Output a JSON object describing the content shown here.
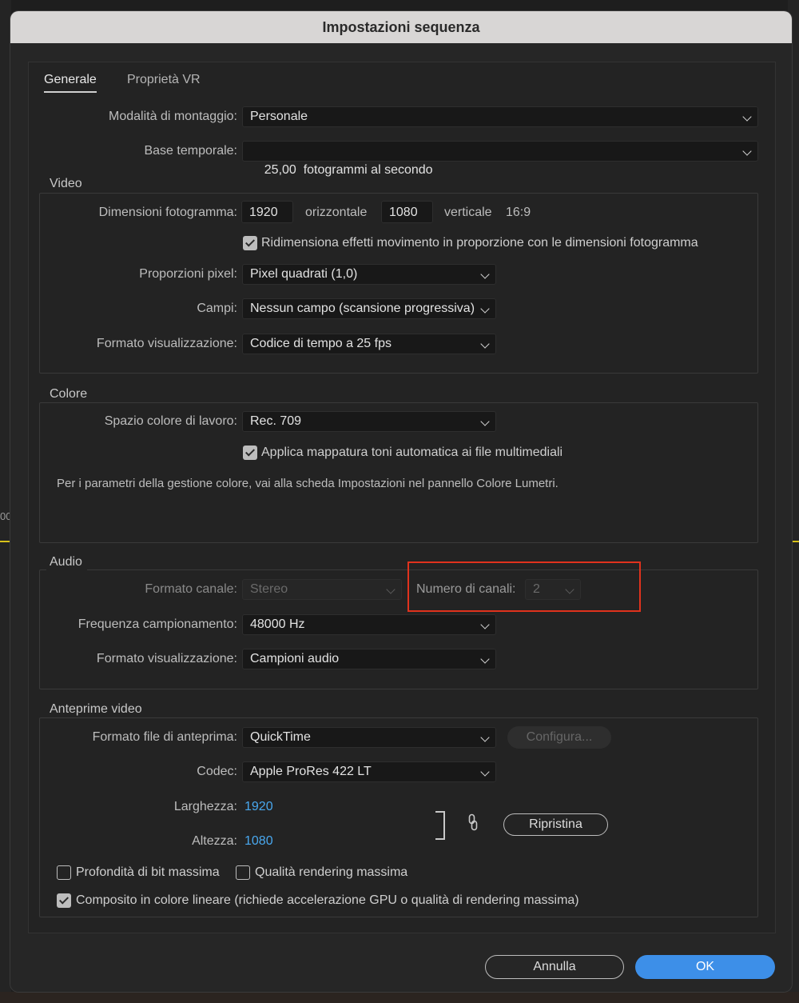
{
  "window": {
    "title": "Impostazioni sequenza"
  },
  "background": {
    "ruler_fragment": "00"
  },
  "tabs": [
    {
      "label": "Generale",
      "active": true
    },
    {
      "label": "Proprietà VR",
      "active": false
    }
  ],
  "general": {
    "editing_mode_label": "Modalità di montaggio:",
    "editing_mode_value": "Personale",
    "timebase_label": "Base temporale:",
    "timebase_value": "25,00  fotogrammi al secondo"
  },
  "video": {
    "title": "Video",
    "frame_size_label": "Dimensioni fotogramma:",
    "width": "1920",
    "horizontal_label": "orizzontale",
    "height": "1080",
    "vertical_label": "verticale",
    "aspect": "16:9",
    "scale_effects_checked": true,
    "scale_effects_label": "Ridimensiona effetti movimento in proporzione con le dimensioni fotogramma",
    "pixel_aspect_label": "Proporzioni pixel:",
    "pixel_aspect_value": "Pixel quadrati (1,0)",
    "fields_label": "Campi:",
    "fields_value": "Nessun campo (scansione progressiva)",
    "display_format_label": "Formato visualizzazione:",
    "display_format_value": "Codice di tempo a 25 fps"
  },
  "color": {
    "title": "Colore",
    "working_space_label": "Spazio colore di lavoro:",
    "working_space_value": "Rec. 709",
    "tone_mapping_checked": true,
    "tone_mapping_label": "Applica mappatura toni automatica ai file multimediali",
    "info_text": "Per i parametri della gestione colore, vai alla scheda Impostazioni nel pannello Colore Lumetri."
  },
  "audio": {
    "title": "Audio",
    "channel_format_label": "Formato canale:",
    "channel_format_value": "Stereo",
    "num_channels_label": "Numero di canali:",
    "num_channels_value": "2",
    "sample_rate_label": "Frequenza campionamento:",
    "sample_rate_value": "48000 Hz",
    "display_format_label": "Formato visualizzazione:",
    "display_format_value": "Campioni audio"
  },
  "previews": {
    "title": "Anteprime video",
    "file_format_label": "Formato file di anteprima:",
    "file_format_value": "QuickTime",
    "configure_label": "Configura...",
    "codec_label": "Codec:",
    "codec_value": "Apple ProRes 422 LT",
    "width_label": "Larghezza:",
    "width_value": "1920",
    "height_label": "Altezza:",
    "height_value": "1080",
    "reset_label": "Ripristina",
    "max_bit_depth_checked": false,
    "max_bit_depth_label": "Profondità di bit massima",
    "max_render_quality_checked": false,
    "max_render_quality_label": "Qualità rendering massima",
    "linear_color_checked": true,
    "linear_color_label": "Composito in colore lineare (richiede accelerazione GPU o qualità di rendering massima)"
  },
  "footer": {
    "cancel_label": "Annulla",
    "ok_label": "OK"
  },
  "colors": {
    "accent": "#3d8fe8",
    "link": "#49a8ef",
    "highlight": "#e0321d",
    "titlebar": "#d8d6d5"
  }
}
